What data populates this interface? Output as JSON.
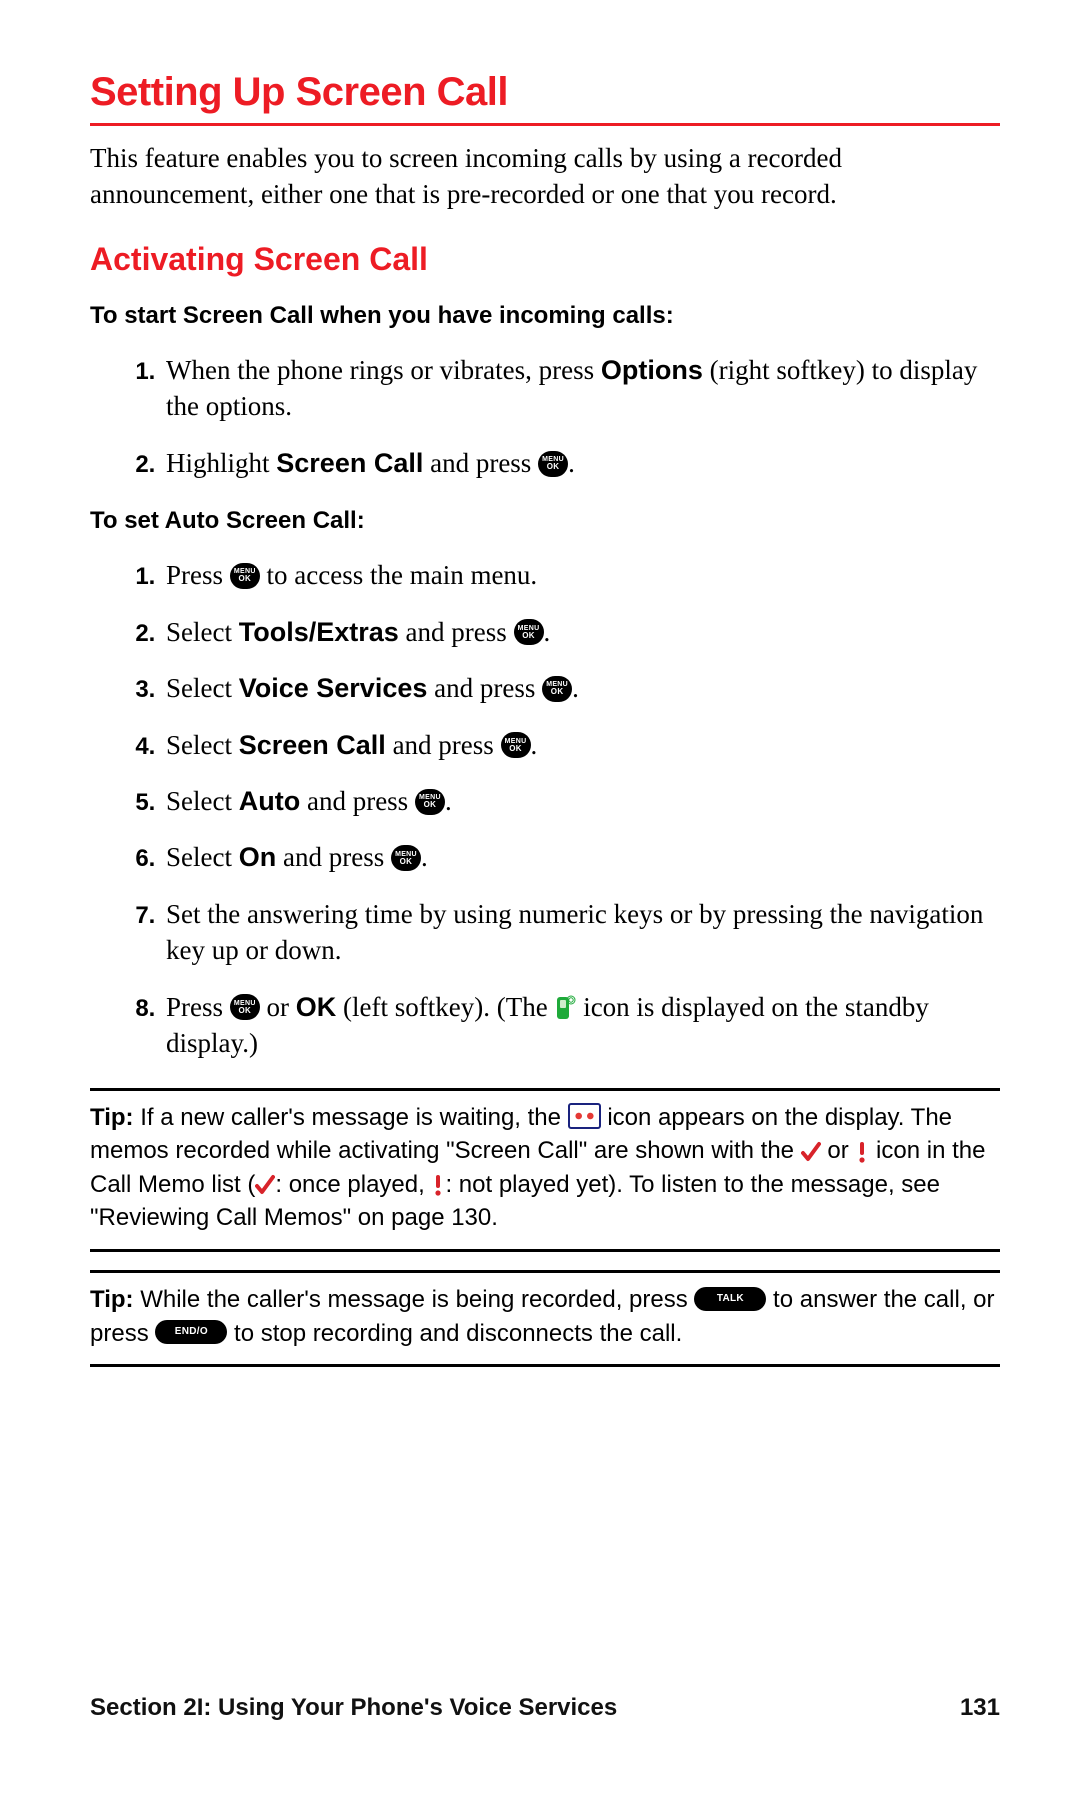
{
  "heading": "Setting Up Screen Call",
  "intro": "This feature enables you to screen incoming calls by using a recorded announcement, either one that is pre-recorded or one that you record.",
  "subheading": "Activating Screen Call",
  "leadin1": "To start Screen Call when you have incoming calls:",
  "steps1": {
    "s1a": "When the phone rings or vibrates, press ",
    "s1b": "Options",
    "s1c": " (right softkey) to display the options.",
    "s2a": "Highlight ",
    "s2b": "Screen Call",
    "s2c": " and press ",
    "s2d": "."
  },
  "leadin2": "To set Auto Screen Call:",
  "steps2": {
    "s1a": "Press ",
    "s1b": " to access the main menu.",
    "s2a": "Select ",
    "s2b": "Tools/Extras",
    "s2c": " and press ",
    "s2d": ".",
    "s3a": "Select ",
    "s3b": "Voice Services",
    "s3c": " and press ",
    "s3d": ".",
    "s4a": "Select ",
    "s4b": "Screen Call",
    "s4c": " and press ",
    "s4d": ".",
    "s5a": "Select ",
    "s5b": "Auto",
    "s5c": " and press ",
    "s5d": ".",
    "s6a": "Select ",
    "s6b": "On",
    "s6c": " and press ",
    "s6d": ".",
    "s7": "Set the answering time by using numeric keys or by pressing the navigation key up or down.",
    "s8a": "Press ",
    "s8b": " or ",
    "s8c": "OK",
    "s8d": " (left softkey). (The ",
    "s8e": " icon is displayed on the standby display.)"
  },
  "tip1": {
    "label": "Tip: ",
    "a": "If a new caller's message is waiting, the ",
    "b": " icon appears on the display. The memos recorded while activating \"Screen Call\" are shown with the ",
    "c": " or ",
    "d": " icon in the Call Memo list (",
    "e": ": once played, ",
    "f": ": not played yet). To listen to the message, see \"Reviewing Call Memos\" on page 130."
  },
  "tip2": {
    "label": "Tip: ",
    "a": "While the caller's message is being recorded, press ",
    "b": " to answer the call, or press ",
    "c": " to stop recording and disconnects the call."
  },
  "keys": {
    "menu": "MENU",
    "ok": "OK",
    "talk": "TALK",
    "endo": "END/O"
  },
  "footer": {
    "section": "Section 2I: Using Your Phone's Voice Services",
    "page": "131"
  }
}
